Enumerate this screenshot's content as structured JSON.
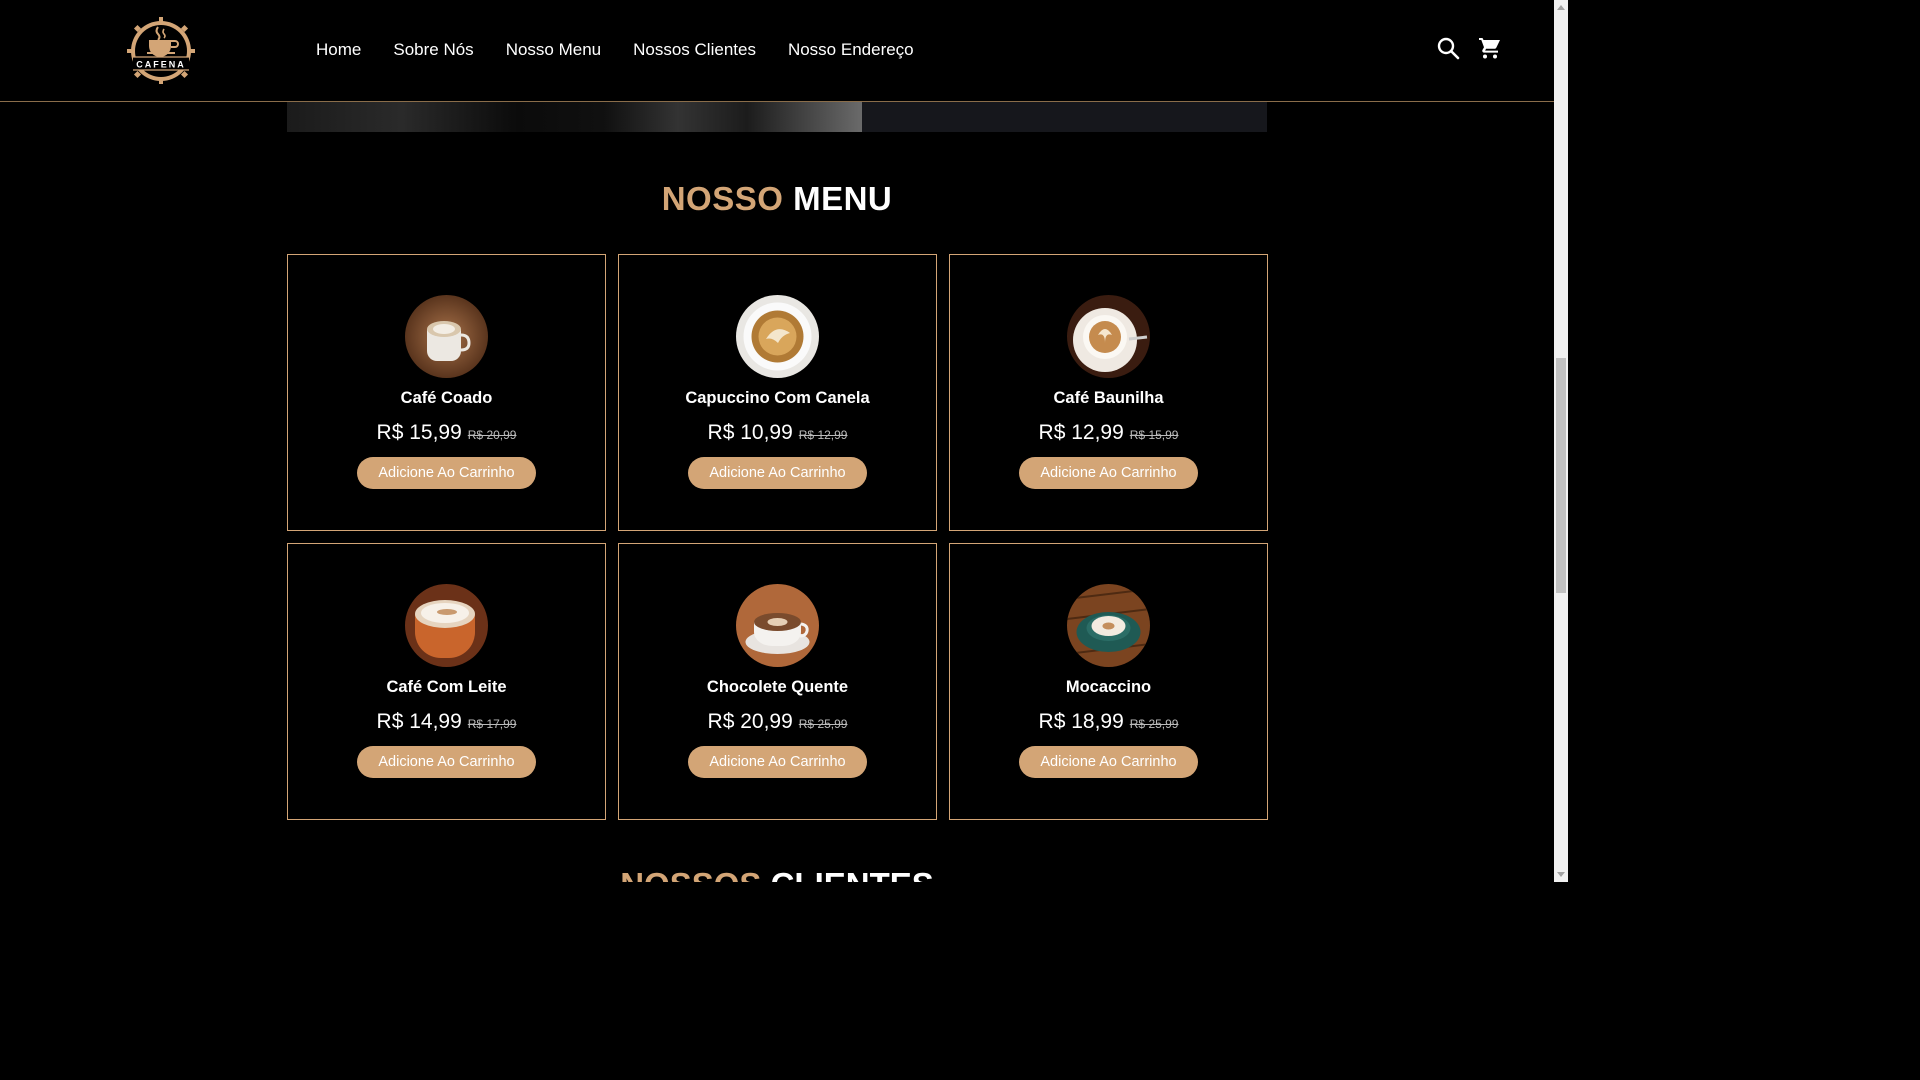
{
  "header": {
    "logo_text": "CAFENA",
    "nav": [
      {
        "label": "Home"
      },
      {
        "label": "Sobre Nós"
      },
      {
        "label": "Nosso Menu"
      },
      {
        "label": "Nossos Clientes"
      },
      {
        "label": "Nosso Endereço"
      }
    ],
    "icons": [
      "search-icon",
      "cart-icon"
    ]
  },
  "menu_section": {
    "title_accent": "NOSSO",
    "title_plain": "MENU",
    "items": [
      {
        "name": "Café Coado",
        "price": "R$ 15,99",
        "old_price": "R$ 20,99",
        "button": "Adicione Ao Carrinho",
        "image": "coffee-cup-latte-art"
      },
      {
        "name": "Capuccino Com Canela",
        "price": "R$ 10,99",
        "old_price": "R$ 12,99",
        "button": "Adicione Ao Carrinho",
        "image": "cappuccino-top-view"
      },
      {
        "name": "Café Baunilha",
        "price": "R$ 12,99",
        "old_price": "R$ 15,99",
        "button": "Adicione Ao Carrinho",
        "image": "latte-art-saucer"
      },
      {
        "name": "Café Com Leite",
        "price": "R$ 14,99",
        "old_price": "R$ 17,99",
        "button": "Adicione Ao Carrinho",
        "image": "coffee-with-milk"
      },
      {
        "name": "Chocolete Quente",
        "price": "R$ 20,99",
        "old_price": "R$ 25,99",
        "button": "Adicione Ao Carrinho",
        "image": "hot-chocolate-cup"
      },
      {
        "name": "Mocaccino",
        "price": "R$ 18,99",
        "old_price": "R$ 25,99",
        "button": "Adicione Ao Carrinho",
        "image": "mocaccino-teal-cup"
      }
    ]
  },
  "next_section": {
    "title_accent": "NOSSOS",
    "title_plain": "CLIENTES"
  },
  "colors": {
    "accent": "#d3a576",
    "background": "#000000",
    "text": "#ffffff"
  }
}
